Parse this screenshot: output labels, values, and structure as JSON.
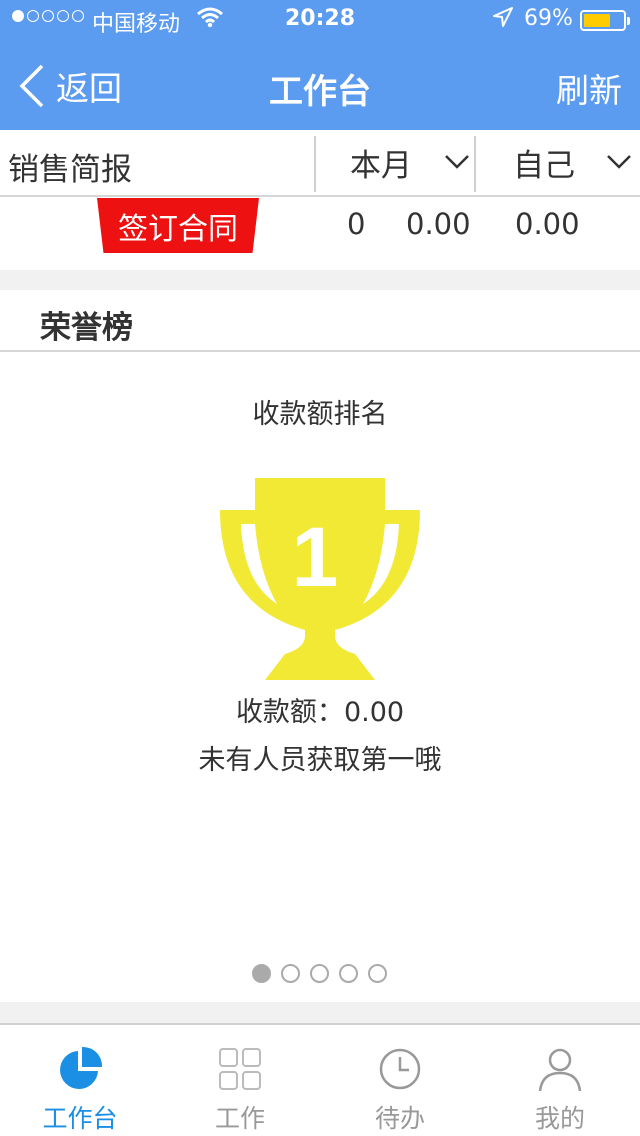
{
  "status_bar": {
    "carrier": "中国移动",
    "time": "20:28",
    "battery_pct": "69%",
    "battery_level": 0.69,
    "signal_bars": 1,
    "signal_total": 5
  },
  "nav": {
    "back_label": "返回",
    "title": "工作台",
    "refresh_label": "刷新"
  },
  "summary": {
    "label": "销售简报",
    "period_filter": "本月",
    "scope_filter": "自己",
    "row": {
      "tag": "签订合同",
      "count": "0",
      "value1": "0.00",
      "value2": "0.00"
    }
  },
  "honor": {
    "title": "荣誉榜",
    "subtitle": "收款额排名",
    "rank": "1",
    "amount_label": "收款额：",
    "amount_value": "0.00",
    "empty_text": "未有人员获取第一哦",
    "pages": 5,
    "active_page": 1
  },
  "tabs": [
    {
      "label": "工作台",
      "icon": "pie-chart-icon",
      "active": true
    },
    {
      "label": "工作",
      "icon": "grid-icon",
      "active": false
    },
    {
      "label": "待办",
      "icon": "clock-icon",
      "active": false
    },
    {
      "label": "我的",
      "icon": "person-icon",
      "active": false
    }
  ],
  "colors": {
    "nav_blue": "#5b9bf0",
    "tag_red": "#ee1111",
    "trophy_yellow": "#f2e935",
    "tab_active": "#1a8fe3",
    "tab_inactive": "#999999",
    "battery_yellow": "#ffcc00"
  }
}
